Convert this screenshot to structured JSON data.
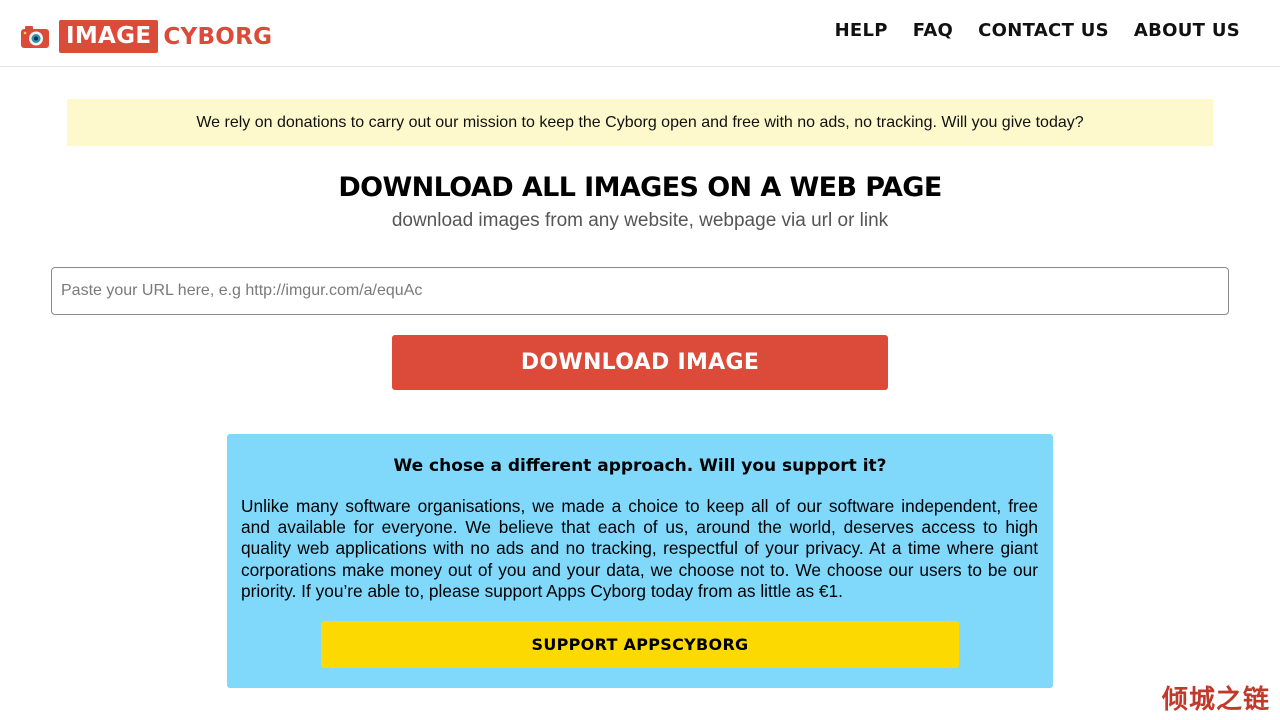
{
  "header": {
    "logo_box_text": "IMAGE",
    "logo_text": "CYBORG",
    "logo_icon": "camera-icon",
    "nav": [
      {
        "label": "HELP"
      },
      {
        "label": "FAQ"
      },
      {
        "label": "CONTACT US"
      },
      {
        "label": "ABOUT US"
      }
    ]
  },
  "banner": {
    "text": "We rely on donations to carry out our mission to keep the Cyborg open and free with no ads, no tracking. Will you give today?"
  },
  "main": {
    "title": "DOWNLOAD ALL IMAGES ON A WEB PAGE",
    "subtitle": "download images from any website, webpage via url or link",
    "url_input": {
      "value": "",
      "placeholder": "Paste your URL here, e.g http://imgur.com/a/equAc"
    },
    "download_button": "DOWNLOAD IMAGE"
  },
  "support": {
    "title": "We chose a different approach. Will you support it?",
    "body": "Unlike many software organisations, we made a choice to keep all of our software independent, free and available for everyone. We believe that each of us, around the world, deserves access to high quality web applications with no ads and no tracking, respectful of your privacy. At a time where giant corporations make money out of you and your data, we choose not to. We choose our users to be our priority. If you’re able to, please support Apps Cyborg today from as little as €1.",
    "button": "SUPPORT APPSCYBORG"
  },
  "watermark": "倾城之链",
  "colors": {
    "brand_red": "#dc4a3a",
    "banner_yellow": "#fef9cc",
    "support_blue": "#80d8fb",
    "support_button_yellow": "#fcd900"
  }
}
